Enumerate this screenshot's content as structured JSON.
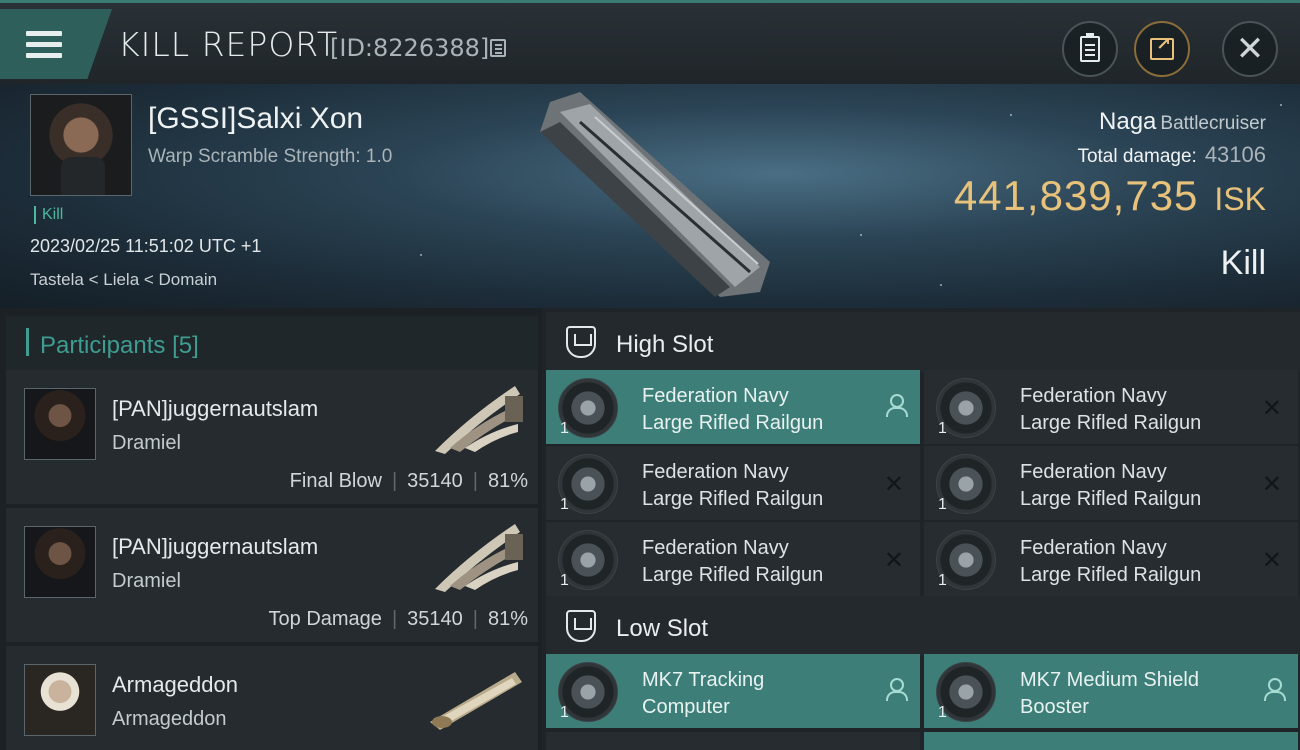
{
  "header": {
    "title": "KILL REPORT",
    "report_id": "[ID:8226388]"
  },
  "victim": {
    "name": "[GSSI]Salxi Xon",
    "warp_scramble": "Warp Scramble Strength: 1.0",
    "tag": "Kill",
    "datetime": "2023/02/25 11:51:02 UTC +1",
    "location": "Tastela < Liela < Domain",
    "ship": "Naga",
    "ship_class": "Battlecruiser",
    "total_damage_label": "Total damage:",
    "total_damage": "43106",
    "isk_value": "441,839,735",
    "isk_unit": "ISK",
    "result": "Kill"
  },
  "participants": {
    "label": "Participants",
    "count": "[5]",
    "rows": [
      {
        "name": "[PAN]juggernautslam",
        "ship": "Dramiel",
        "role": "Final Blow",
        "damage": "35140",
        "percent": "81%"
      },
      {
        "name": "[PAN]juggernautslam",
        "ship": "Dramiel",
        "role": "Top Damage",
        "damage": "35140",
        "percent": "81%"
      },
      {
        "name": "Armageddon",
        "ship": "Armageddon",
        "role": "",
        "damage": "",
        "percent": ""
      }
    ]
  },
  "fittings": {
    "high_slot_label": "High Slot",
    "low_slot_label": "Low Slot",
    "high_slot": [
      {
        "line1": "Federation Navy",
        "line2": "Large Rifled Railgun",
        "qty": "1",
        "status": "person-icon",
        "active": true
      },
      {
        "line1": "Federation Navy",
        "line2": "Large Rifled Railgun",
        "qty": "1",
        "status": "x-icon",
        "active": false
      },
      {
        "line1": "Federation Navy",
        "line2": "Large Rifled Railgun",
        "qty": "1",
        "status": "x-icon",
        "active": false
      },
      {
        "line1": "Federation Navy",
        "line2": "Large Rifled Railgun",
        "qty": "1",
        "status": "x-icon",
        "active": false
      },
      {
        "line1": "Federation Navy",
        "line2": "Large Rifled Railgun",
        "qty": "1",
        "status": "x-icon",
        "active": false
      },
      {
        "line1": "Federation Navy",
        "line2": "Large Rifled Railgun",
        "qty": "1",
        "status": "x-icon",
        "active": false
      }
    ],
    "low_slot": [
      {
        "line1": "MK7 Tracking",
        "line2": "Computer",
        "qty": "1",
        "status": "person-icon",
        "active": true
      },
      {
        "line1": "MK7 Medium Shield",
        "line2": "Booster",
        "qty": "1",
        "status": "person-icon",
        "active": true
      }
    ]
  },
  "colors": {
    "accent_teal": "#3e9c90",
    "active_row": "#3d7f78",
    "isk_gold": "#e8c27a"
  }
}
